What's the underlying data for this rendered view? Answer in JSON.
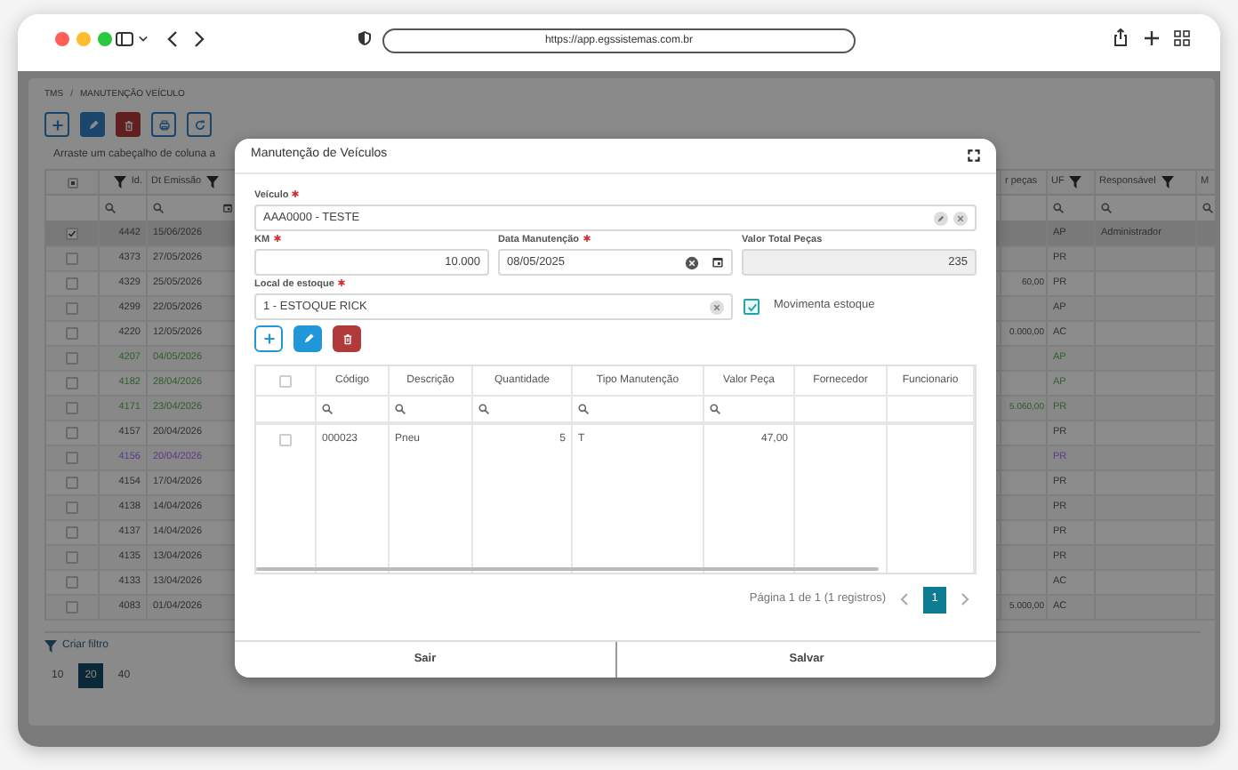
{
  "browser": {
    "url": "https://app.egssistemas.com.br"
  },
  "breadcrumb": [
    "TMS",
    "MANUTENÇÃO VEÍCULO"
  ],
  "breadcrumb_separator": "/",
  "toolbar": [
    {
      "kind": "add"
    },
    {
      "kind": "edit"
    },
    {
      "kind": "delete"
    },
    {
      "kind": "print"
    },
    {
      "kind": "refresh"
    }
  ],
  "group_hint": "Arraste um cabeçalho de coluna a",
  "grid": {
    "select_all": {
      "indeterminate": true
    },
    "columns": [
      {
        "label": "Id.",
        "filter": true
      },
      {
        "label": "Dt Emissão",
        "filter": true
      },
      {
        "label": "r peças",
        "filter": false
      },
      {
        "label": "UF",
        "filter": true
      },
      {
        "label": "Responsável",
        "filter": true
      },
      {
        "label": "M",
        "filter": false
      }
    ],
    "rows": [
      {
        "selected": true,
        "id": "4442",
        "date": "15/06/2026",
        "value": "",
        "uf": "AP",
        "responsavel": "Administrador",
        "color": "#2f2f2f"
      },
      {
        "selected": false,
        "id": "4373",
        "date": "27/05/2026",
        "value": "",
        "uf": "PR",
        "responsavel": "",
        "color": "#2f2f2f"
      },
      {
        "selected": false,
        "id": "4329",
        "date": "25/05/2026",
        "value": "60,00",
        "uf": "PR",
        "responsavel": "",
        "color": "#2f2f2f"
      },
      {
        "selected": false,
        "id": "4299",
        "date": "22/05/2026",
        "value": "",
        "uf": "AP",
        "responsavel": "",
        "color": "#2f2f2f"
      },
      {
        "selected": false,
        "id": "4220",
        "date": "12/05/2026",
        "value": "0.000,00",
        "uf": "AC",
        "responsavel": "",
        "color": "#2f2f2f"
      },
      {
        "selected": false,
        "id": "4207",
        "date": "04/05/2026",
        "value": "",
        "uf": "AP",
        "responsavel": "",
        "color": "#2f5e2c"
      },
      {
        "selected": false,
        "id": "4182",
        "date": "28/04/2026",
        "value": "",
        "uf": "AP",
        "responsavel": "",
        "color": "#2f5e2c"
      },
      {
        "selected": false,
        "id": "4171",
        "date": "23/04/2026",
        "value": "5.060,00",
        "uf": "PR",
        "responsavel": "",
        "color": "#2f5e2c"
      },
      {
        "selected": false,
        "id": "4157",
        "date": "20/04/2026",
        "value": "",
        "uf": "PR",
        "responsavel": "",
        "color": "#2f2f2f"
      },
      {
        "selected": false,
        "id": "4156",
        "date": "20/04/2026",
        "value": "",
        "uf": "PR",
        "responsavel": "",
        "color": "#5b3a8c"
      },
      {
        "selected": false,
        "id": "4154",
        "date": "17/04/2026",
        "value": "",
        "uf": "PR",
        "responsavel": "",
        "color": "#2f2f2f"
      },
      {
        "selected": false,
        "id": "4138",
        "date": "14/04/2026",
        "value": "",
        "uf": "PR",
        "responsavel": "",
        "color": "#2f2f2f"
      },
      {
        "selected": false,
        "id": "4137",
        "date": "14/04/2026",
        "value": "",
        "uf": "PR",
        "responsavel": "",
        "color": "#2f2f2f"
      },
      {
        "selected": false,
        "id": "4135",
        "date": "13/04/2026",
        "value": "",
        "uf": "PR",
        "responsavel": "",
        "color": "#2f2f2f"
      },
      {
        "selected": false,
        "id": "4133",
        "date": "13/04/2026",
        "value": "",
        "uf": "AC",
        "responsavel": "",
        "color": "#2f2f2f"
      },
      {
        "selected": false,
        "id": "4083",
        "date": "01/04/2026",
        "value": "5.000,00",
        "uf": "AC",
        "responsavel": "",
        "color": "#2f2f2f"
      }
    ]
  },
  "filter_link": "Criar filtro",
  "page_sizes": [
    {
      "label": "10",
      "selected": false
    },
    {
      "label": "20",
      "selected": true
    },
    {
      "label": "40",
      "selected": false
    }
  ],
  "modal": {
    "title": "Manutenção de Veículos",
    "vehicle": {
      "label": "Veículo",
      "required": true,
      "value": "AAA0000 - TESTE"
    },
    "km": {
      "label": "KM",
      "required": true,
      "value": "10.000"
    },
    "date": {
      "label": "Data Manutenção",
      "required": true,
      "value": "08/05/2025"
    },
    "total": {
      "label": "Valor Total Peças",
      "required": false,
      "disabled": true,
      "value": "235"
    },
    "stock": {
      "label": "Local de estoque",
      "required": true,
      "value": "1 - ESTOQUE RICK"
    },
    "move_stock": {
      "label": "Movimenta estoque",
      "checked": true
    },
    "actions": [
      {
        "kind": "add"
      },
      {
        "kind": "edit"
      },
      {
        "kind": "delete"
      }
    ],
    "items": {
      "select_all": {
        "checked": false
      },
      "columns": [
        {
          "label": "Código",
          "kind": "text",
          "filter": true
        },
        {
          "label": "Descrição",
          "kind": "text",
          "filter": true
        },
        {
          "label": "Quantidade",
          "kind": "number",
          "filter": true
        },
        {
          "label": "Tipo Manutenção",
          "kind": "text",
          "filter": true
        },
        {
          "label": "Valor Peça",
          "kind": "number",
          "filter": true
        },
        {
          "label": "Fornecedor",
          "kind": "text",
          "filter": false
        },
        {
          "label": "Funcionario",
          "kind": "text",
          "filter": false
        }
      ],
      "rows": [
        {
          "selected": false,
          "cells": [
            "000023",
            "Pneu",
            "5",
            "T",
            "47,00"
          ]
        }
      ]
    },
    "pager": {
      "summary": "Página 1 de 1 (1 registros)",
      "pages": [
        {
          "label": "1",
          "selected": true
        }
      ]
    },
    "buttons": [
      "Sair",
      "Salvar"
    ]
  }
}
